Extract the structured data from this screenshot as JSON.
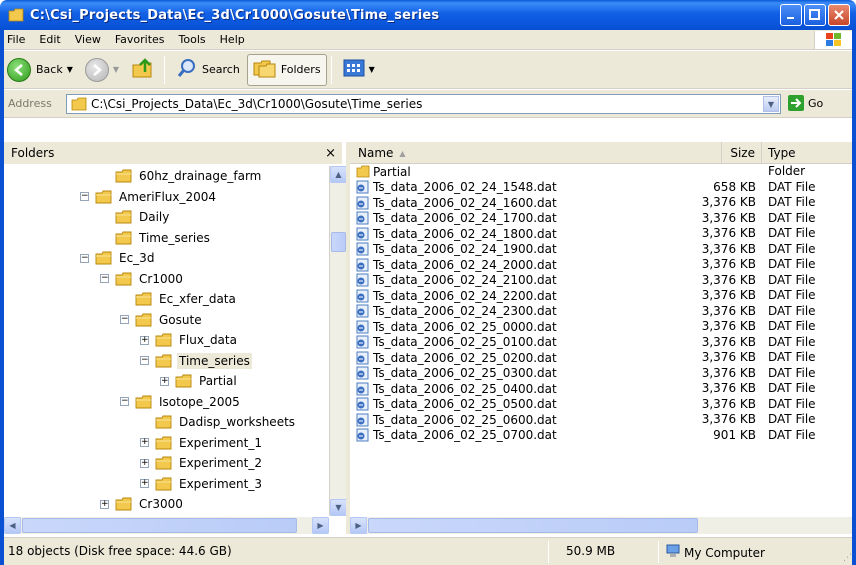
{
  "window": {
    "title": "C:\\Csi_Projects_Data\\Ec_3d\\Cr1000\\Gosute\\Time_series"
  },
  "menu": [
    "File",
    "Edit",
    "View",
    "Favorites",
    "Tools",
    "Help"
  ],
  "toolbar": {
    "back_label": "Back",
    "search_label": "Search",
    "folders_label": "Folders"
  },
  "address": {
    "label": "Address",
    "value": "C:\\Csi_Projects_Data\\Ec_3d\\Cr1000\\Gosute\\Time_series",
    "go_label": "Go"
  },
  "folders_pane": {
    "title": "Folders",
    "close": "×",
    "tree": [
      {
        "label": "60hz_drainage_farm",
        "level": 3,
        "expander": ""
      },
      {
        "label": "AmeriFlux_2004",
        "level": 2,
        "expander": "−"
      },
      {
        "label": "Daily",
        "level": 3,
        "expander": ""
      },
      {
        "label": "Time_series",
        "level": 3,
        "expander": ""
      },
      {
        "label": "Ec_3d",
        "level": 2,
        "expander": "−"
      },
      {
        "label": "Cr1000",
        "level": 3,
        "expander": "−"
      },
      {
        "label": "Ec_xfer_data",
        "level": 4,
        "expander": ""
      },
      {
        "label": "Gosute",
        "level": 4,
        "expander": "−"
      },
      {
        "label": "Flux_data",
        "level": 5,
        "expander": "+"
      },
      {
        "label": "Time_series",
        "level": 5,
        "expander": "−",
        "selected": true
      },
      {
        "label": "Partial",
        "level": 6,
        "expander": "+"
      },
      {
        "label": "Isotope_2005",
        "level": 4,
        "expander": "−"
      },
      {
        "label": "Dadisp_worksheets",
        "level": 5,
        "expander": ""
      },
      {
        "label": "Experiment_1",
        "level": 5,
        "expander": "+"
      },
      {
        "label": "Experiment_2",
        "level": 5,
        "expander": "+"
      },
      {
        "label": "Experiment_3",
        "level": 5,
        "expander": "+"
      },
      {
        "label": "Cr3000",
        "level": 3,
        "expander": "+"
      }
    ]
  },
  "list": {
    "columns": {
      "name": "Name",
      "size": "Size",
      "type": "Type"
    },
    "rows": [
      {
        "name": "Partial",
        "size": "",
        "type": "Folder",
        "kind": "folder"
      },
      {
        "name": "Ts_data_2006_02_24_1548.dat",
        "size": "658 KB",
        "type": "DAT File",
        "kind": "dat"
      },
      {
        "name": "Ts_data_2006_02_24_1600.dat",
        "size": "3,376 KB",
        "type": "DAT File",
        "kind": "dat"
      },
      {
        "name": "Ts_data_2006_02_24_1700.dat",
        "size": "3,376 KB",
        "type": "DAT File",
        "kind": "dat"
      },
      {
        "name": "Ts_data_2006_02_24_1800.dat",
        "size": "3,376 KB",
        "type": "DAT File",
        "kind": "dat"
      },
      {
        "name": "Ts_data_2006_02_24_1900.dat",
        "size": "3,376 KB",
        "type": "DAT File",
        "kind": "dat"
      },
      {
        "name": "Ts_data_2006_02_24_2000.dat",
        "size": "3,376 KB",
        "type": "DAT File",
        "kind": "dat"
      },
      {
        "name": "Ts_data_2006_02_24_2100.dat",
        "size": "3,376 KB",
        "type": "DAT File",
        "kind": "dat"
      },
      {
        "name": "Ts_data_2006_02_24_2200.dat",
        "size": "3,376 KB",
        "type": "DAT File",
        "kind": "dat"
      },
      {
        "name": "Ts_data_2006_02_24_2300.dat",
        "size": "3,376 KB",
        "type": "DAT File",
        "kind": "dat"
      },
      {
        "name": "Ts_data_2006_02_25_0000.dat",
        "size": "3,376 KB",
        "type": "DAT File",
        "kind": "dat"
      },
      {
        "name": "Ts_data_2006_02_25_0100.dat",
        "size": "3,376 KB",
        "type": "DAT File",
        "kind": "dat"
      },
      {
        "name": "Ts_data_2006_02_25_0200.dat",
        "size": "3,376 KB",
        "type": "DAT File",
        "kind": "dat"
      },
      {
        "name": "Ts_data_2006_02_25_0300.dat",
        "size": "3,376 KB",
        "type": "DAT File",
        "kind": "dat"
      },
      {
        "name": "Ts_data_2006_02_25_0400.dat",
        "size": "3,376 KB",
        "type": "DAT File",
        "kind": "dat"
      },
      {
        "name": "Ts_data_2006_02_25_0500.dat",
        "size": "3,376 KB",
        "type": "DAT File",
        "kind": "dat"
      },
      {
        "name": "Ts_data_2006_02_25_0600.dat",
        "size": "3,376 KB",
        "type": "DAT File",
        "kind": "dat"
      },
      {
        "name": "Ts_data_2006_02_25_0700.dat",
        "size": "901 KB",
        "type": "DAT File",
        "kind": "dat"
      }
    ]
  },
  "status": {
    "objects": "18 objects (Disk free space: 44.6 GB)",
    "size": "50.9 MB",
    "zone": "My Computer"
  },
  "colors": {
    "titlebar": "#0a5ad8",
    "folder": "#f2c94c",
    "chrome": "#ece9d8"
  }
}
